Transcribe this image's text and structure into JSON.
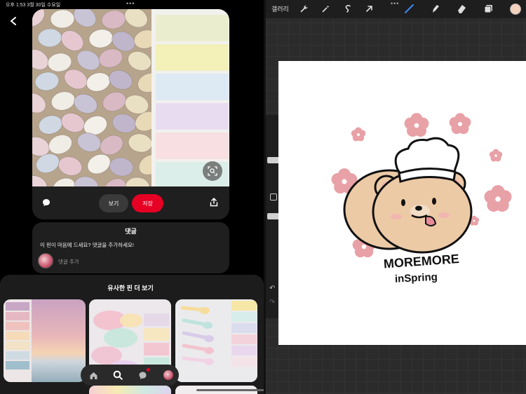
{
  "status_bar": {
    "time": "오후 1:53  3월 30일 수요일",
    "dots": "•••"
  },
  "pin": {
    "view_label": "보기",
    "save_label": "저장",
    "palette": [
      "#ebedcf",
      "#f3f0b8",
      "#dde9f3",
      "#e8ddf0",
      "#f7dfe2",
      "#dbeee9"
    ]
  },
  "comments": {
    "title": "댓글",
    "prompt": "이 핀이 마음에 드세요? 댓글을 추가하세요!",
    "add_placeholder": "댓글 추가"
  },
  "more_like_this": {
    "title": "유사한 핀 더 보기"
  },
  "procreate": {
    "gallery_label": "갤러리",
    "toolbar_dots": "•••",
    "undo": "↶",
    "redo": "↷",
    "artwork_line1": "MOREMORE",
    "artwork_line2": "inSpring"
  },
  "colors": {
    "save_red": "#e60023",
    "flower_pink": "#e8a1a6",
    "current_color": "#f5d2bd"
  }
}
